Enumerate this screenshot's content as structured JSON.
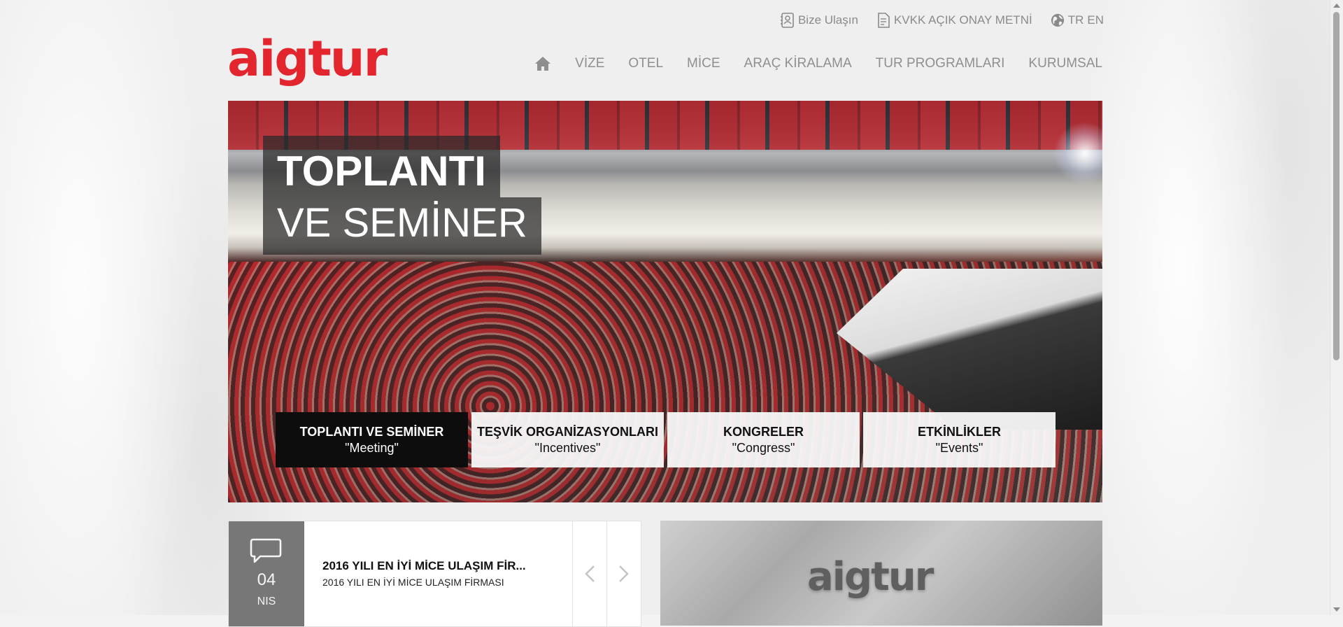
{
  "topbar": {
    "contact_label": "Bize Ulaşın",
    "kvkk_label": "KVKK AÇIK ONAY METNİ",
    "lang_tr": "TR",
    "lang_en": "EN"
  },
  "brand": {
    "logo_text": "aigtur",
    "color": "#e3262e"
  },
  "nav": {
    "items": [
      "VİZE",
      "OTEL",
      "MİCE",
      "ARAÇ KİRALAMA",
      "TUR PROGRAMLARI",
      "KURUMSAL"
    ]
  },
  "hero": {
    "title_line1": "TOPLANTI",
    "title_line2": "VE SEMİNER",
    "categories": [
      {
        "title": "TOPLANTI VE SEMİNER",
        "sub": "\"Meeting\"",
        "active": true
      },
      {
        "title": "TEŞVİK ORGANİZASYONLARI",
        "sub": "\"Incentives\"",
        "active": false
      },
      {
        "title": "KONGRELER",
        "sub": "\"Congress\"",
        "active": false
      },
      {
        "title": "ETKİNLİKLER",
        "sub": "\"Events\"",
        "active": false
      }
    ]
  },
  "news": {
    "day": "04",
    "month": "NIS",
    "title": "2016 YILI EN İYİ MİCE ULAŞIM FİR...",
    "subtitle": "2016 YILI EN İYİ MİCE ULAŞIM FİRMASI",
    "prev_icon": "chevron-left-icon",
    "next_icon": "chevron-right-icon"
  },
  "promo": {
    "logo_text": "aigtur"
  }
}
